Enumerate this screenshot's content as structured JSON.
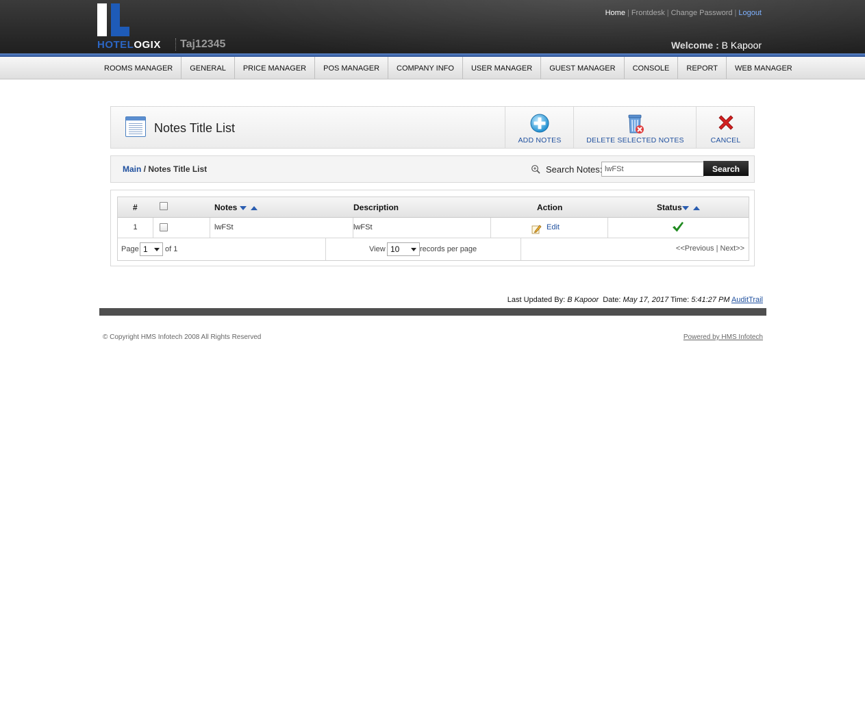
{
  "header": {
    "brand_part1": "HOTEL",
    "brand_part2": "OGIX",
    "hotel_code": "Taj12345",
    "top_links": {
      "home": "Home",
      "frontdesk": "Frontdesk",
      "change_password": "Change Password",
      "logout": "Logout"
    },
    "welcome_label": "Welcome :",
    "user_name": "B Kapoor"
  },
  "nav": {
    "items": [
      "ROOMS MANAGER",
      "GENERAL",
      "PRICE MANAGER",
      "POS MANAGER",
      "COMPANY INFO",
      "USER MANAGER",
      "GUEST MANAGER",
      "CONSOLE",
      "REPORT",
      "WEB MANAGER"
    ]
  },
  "title_panel": {
    "title": "Notes Title List",
    "add_label": "ADD NOTES",
    "delete_label": "DELETE SELECTED NOTES",
    "cancel_label": "CANCEL"
  },
  "breadcrumb": {
    "main": "Main",
    "separator": "/",
    "current": "Notes Title List"
  },
  "search": {
    "label": "Search Notes:",
    "value": "lwFSt",
    "button": "Search"
  },
  "table": {
    "columns": {
      "num": "#",
      "notes": "Notes",
      "description": "Description",
      "action": "Action",
      "status": "Status"
    },
    "rows": [
      {
        "num": "1",
        "notes": "lwFSt",
        "description": "lwFSt",
        "action": "Edit"
      }
    ],
    "footer": {
      "page_label": "Page",
      "page_value": "1",
      "of_label": "of 1",
      "view_label": "View",
      "per_page_value": "10",
      "records_label": "records per page",
      "previous": "<<Previous",
      "pager_sep": "|",
      "next": "Next>>"
    }
  },
  "last_updated": {
    "label": "Last Updated By:",
    "by": "B Kapoor",
    "date_label": "Date:",
    "date": "May 17, 2017",
    "time_label": "Time:",
    "time": "5:41:27 PM",
    "audit": "AuditTrail"
  },
  "footer": {
    "copyright": "© Copyright HMS Infotech 2008 All Rights Reserved",
    "powered": "Powered by HMS Infotech"
  },
  "colors": {
    "accent_blue": "#1e4f9e",
    "check_green": "#1f8a1f",
    "cancel_red": "#d21f1f"
  }
}
